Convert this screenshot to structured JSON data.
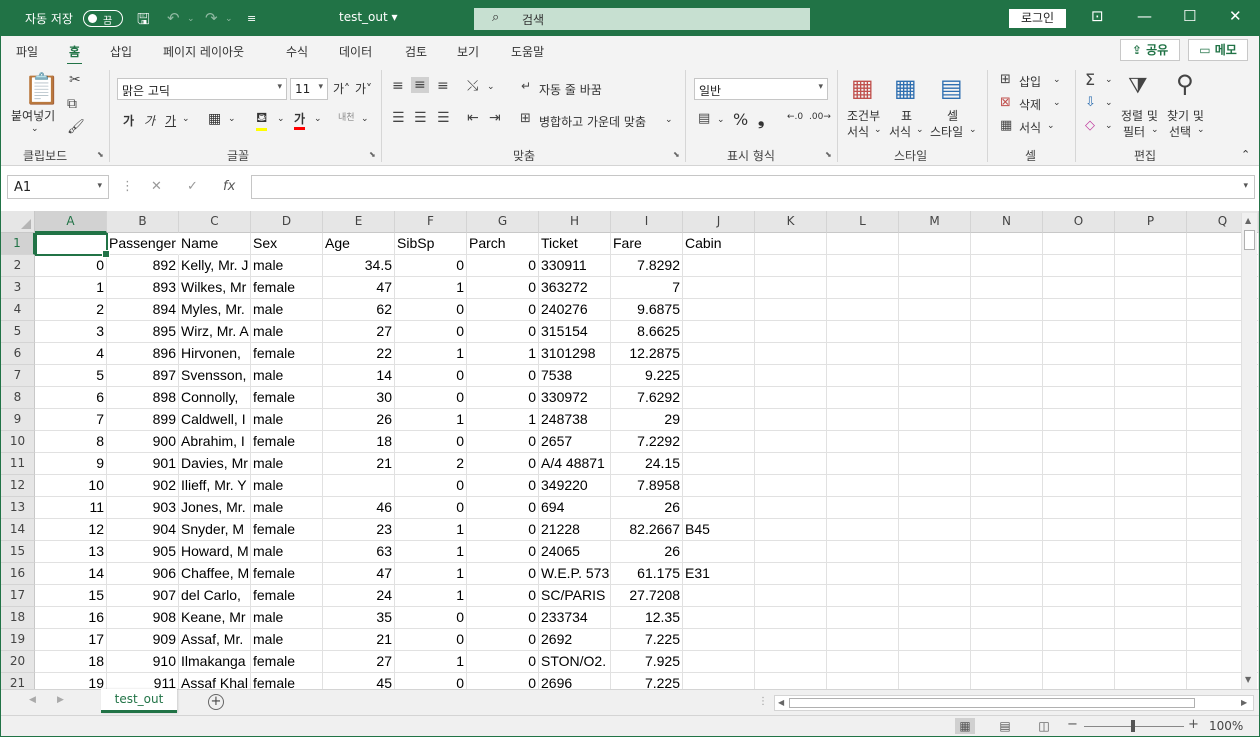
{
  "titlebar": {
    "autosave_label": "자동 저장",
    "autosave_state": "끔",
    "doc_title": "test_out ▾",
    "search_placeholder": "검색",
    "login_label": "로그인"
  },
  "menu": {
    "items": [
      "파일",
      "홈",
      "삽입",
      "페이지 레이아웃",
      "수식",
      "데이터",
      "검토",
      "보기",
      "도움말"
    ],
    "active": "홈",
    "share_label": "공유",
    "memo_label": "메모"
  },
  "ribbon": {
    "clipboard": {
      "paste_label": "붙여넣기",
      "group_label": "클립보드"
    },
    "font": {
      "font_name": "맑은 고딕",
      "font_size": "11",
      "group_label": "글꼴"
    },
    "alignment": {
      "wrap_text": "자동 줄 바꿈",
      "merge_center": "병합하고 가운데 맞춤",
      "group_label": "맞춤"
    },
    "number": {
      "format": "일반",
      "group_label": "표시 형식"
    },
    "styles": {
      "conditional_l1": "조건부",
      "conditional_l2": "서식",
      "table_l1": "표",
      "table_l2": "서식",
      "cell_l1": "셀",
      "cell_l2": "스타일",
      "group_label": "스타일"
    },
    "cells": {
      "insert": "삽입",
      "delete": "삭제",
      "format": "서식",
      "group_label": "셀"
    },
    "editing": {
      "sort_l1": "정렬 및",
      "sort_l2": "필터",
      "find_l1": "찾기 및",
      "find_l2": "선택",
      "group_label": "편집"
    }
  },
  "formula_bar": {
    "name_box": "A1",
    "formula": ""
  },
  "columns": [
    "A",
    "B",
    "C",
    "D",
    "E",
    "F",
    "G",
    "H",
    "I",
    "J",
    "K",
    "L",
    "M",
    "N",
    "O",
    "P",
    "Q"
  ],
  "selected_cell": "A1",
  "header_row": [
    "",
    "Passenger",
    "Name",
    "Sex",
    "Age",
    "SibSp",
    "Parch",
    "Ticket",
    "Fare",
    "Cabin"
  ],
  "rows": [
    [
      "0",
      "892",
      "Kelly, Mr. J",
      "male",
      "34.5",
      "0",
      "0",
      "330911",
      "7.8292",
      ""
    ],
    [
      "1",
      "893",
      "Wilkes, Mr",
      "female",
      "47",
      "1",
      "0",
      "363272",
      "7",
      ""
    ],
    [
      "2",
      "894",
      "Myles, Mr.",
      "male",
      "62",
      "0",
      "0",
      "240276",
      "9.6875",
      ""
    ],
    [
      "3",
      "895",
      "Wirz, Mr. A",
      "male",
      "27",
      "0",
      "0",
      "315154",
      "8.6625",
      ""
    ],
    [
      "4",
      "896",
      "Hirvonen,",
      "female",
      "22",
      "1",
      "1",
      "3101298",
      "12.2875",
      ""
    ],
    [
      "5",
      "897",
      "Svensson,",
      "male",
      "14",
      "0",
      "0",
      "7538",
      "9.225",
      ""
    ],
    [
      "6",
      "898",
      "Connolly,",
      "female",
      "30",
      "0",
      "0",
      "330972",
      "7.6292",
      ""
    ],
    [
      "7",
      "899",
      "Caldwell, I",
      "male",
      "26",
      "1",
      "1",
      "248738",
      "29",
      ""
    ],
    [
      "8",
      "900",
      "Abrahim, I",
      "female",
      "18",
      "0",
      "0",
      "2657",
      "7.2292",
      ""
    ],
    [
      "9",
      "901",
      "Davies, Mr",
      "male",
      "21",
      "2",
      "0",
      "A/4 48871",
      "24.15",
      ""
    ],
    [
      "10",
      "902",
      "Ilieff, Mr. Y",
      "male",
      "",
      "0",
      "0",
      "349220",
      "7.8958",
      ""
    ],
    [
      "11",
      "903",
      "Jones, Mr.",
      "male",
      "46",
      "0",
      "0",
      "694",
      "26",
      ""
    ],
    [
      "12",
      "904",
      "Snyder, M",
      "female",
      "23",
      "1",
      "0",
      "21228",
      "82.2667",
      "B45"
    ],
    [
      "13",
      "905",
      "Howard, M",
      "male",
      "63",
      "1",
      "0",
      "24065",
      "26",
      ""
    ],
    [
      "14",
      "906",
      "Chaffee, M",
      "female",
      "47",
      "1",
      "0",
      "W.E.P. 573",
      "61.175",
      "E31"
    ],
    [
      "15",
      "907",
      "del Carlo,",
      "female",
      "24",
      "1",
      "0",
      "SC/PARIS",
      "27.7208",
      ""
    ],
    [
      "16",
      "908",
      "Keane, Mr",
      "male",
      "35",
      "0",
      "0",
      "233734",
      "12.35",
      ""
    ],
    [
      "17",
      "909",
      "Assaf, Mr.",
      "male",
      "21",
      "0",
      "0",
      "2692",
      "7.225",
      ""
    ],
    [
      "18",
      "910",
      "Ilmakanga",
      "female",
      "27",
      "1",
      "0",
      "STON/O2.",
      "7.925",
      ""
    ],
    [
      "19",
      "911",
      "Assaf Khal",
      "female",
      "45",
      "0",
      "0",
      "2696",
      "7.225",
      ""
    ]
  ],
  "numeric_columns": [
    0,
    1,
    4,
    5,
    6,
    8
  ],
  "sheet_tabs": [
    "test_out"
  ],
  "status": {
    "zoom": "100%"
  },
  "colors": {
    "accent": "#217346"
  }
}
